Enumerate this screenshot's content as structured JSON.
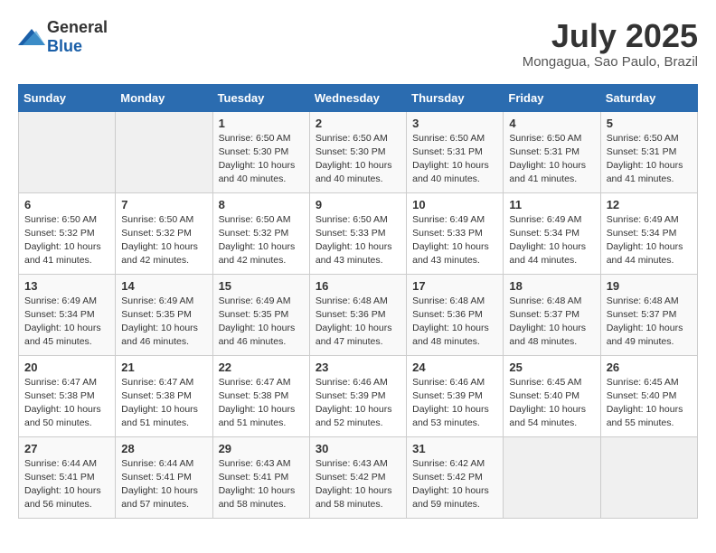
{
  "header": {
    "logo": {
      "general": "General",
      "blue": "Blue"
    },
    "title": "July 2025",
    "location": "Mongagua, Sao Paulo, Brazil"
  },
  "calendar": {
    "weekdays": [
      "Sunday",
      "Monday",
      "Tuesday",
      "Wednesday",
      "Thursday",
      "Friday",
      "Saturday"
    ],
    "weeks": [
      [
        {
          "day": "",
          "info": ""
        },
        {
          "day": "",
          "info": ""
        },
        {
          "day": "1",
          "info": "Sunrise: 6:50 AM\nSunset: 5:30 PM\nDaylight: 10 hours\nand 40 minutes."
        },
        {
          "day": "2",
          "info": "Sunrise: 6:50 AM\nSunset: 5:30 PM\nDaylight: 10 hours\nand 40 minutes."
        },
        {
          "day": "3",
          "info": "Sunrise: 6:50 AM\nSunset: 5:31 PM\nDaylight: 10 hours\nand 40 minutes."
        },
        {
          "day": "4",
          "info": "Sunrise: 6:50 AM\nSunset: 5:31 PM\nDaylight: 10 hours\nand 41 minutes."
        },
        {
          "day": "5",
          "info": "Sunrise: 6:50 AM\nSunset: 5:31 PM\nDaylight: 10 hours\nand 41 minutes."
        }
      ],
      [
        {
          "day": "6",
          "info": "Sunrise: 6:50 AM\nSunset: 5:32 PM\nDaylight: 10 hours\nand 41 minutes."
        },
        {
          "day": "7",
          "info": "Sunrise: 6:50 AM\nSunset: 5:32 PM\nDaylight: 10 hours\nand 42 minutes."
        },
        {
          "day": "8",
          "info": "Sunrise: 6:50 AM\nSunset: 5:32 PM\nDaylight: 10 hours\nand 42 minutes."
        },
        {
          "day": "9",
          "info": "Sunrise: 6:50 AM\nSunset: 5:33 PM\nDaylight: 10 hours\nand 43 minutes."
        },
        {
          "day": "10",
          "info": "Sunrise: 6:49 AM\nSunset: 5:33 PM\nDaylight: 10 hours\nand 43 minutes."
        },
        {
          "day": "11",
          "info": "Sunrise: 6:49 AM\nSunset: 5:34 PM\nDaylight: 10 hours\nand 44 minutes."
        },
        {
          "day": "12",
          "info": "Sunrise: 6:49 AM\nSunset: 5:34 PM\nDaylight: 10 hours\nand 44 minutes."
        }
      ],
      [
        {
          "day": "13",
          "info": "Sunrise: 6:49 AM\nSunset: 5:34 PM\nDaylight: 10 hours\nand 45 minutes."
        },
        {
          "day": "14",
          "info": "Sunrise: 6:49 AM\nSunset: 5:35 PM\nDaylight: 10 hours\nand 46 minutes."
        },
        {
          "day": "15",
          "info": "Sunrise: 6:49 AM\nSunset: 5:35 PM\nDaylight: 10 hours\nand 46 minutes."
        },
        {
          "day": "16",
          "info": "Sunrise: 6:48 AM\nSunset: 5:36 PM\nDaylight: 10 hours\nand 47 minutes."
        },
        {
          "day": "17",
          "info": "Sunrise: 6:48 AM\nSunset: 5:36 PM\nDaylight: 10 hours\nand 48 minutes."
        },
        {
          "day": "18",
          "info": "Sunrise: 6:48 AM\nSunset: 5:37 PM\nDaylight: 10 hours\nand 48 minutes."
        },
        {
          "day": "19",
          "info": "Sunrise: 6:48 AM\nSunset: 5:37 PM\nDaylight: 10 hours\nand 49 minutes."
        }
      ],
      [
        {
          "day": "20",
          "info": "Sunrise: 6:47 AM\nSunset: 5:38 PM\nDaylight: 10 hours\nand 50 minutes."
        },
        {
          "day": "21",
          "info": "Sunrise: 6:47 AM\nSunset: 5:38 PM\nDaylight: 10 hours\nand 51 minutes."
        },
        {
          "day": "22",
          "info": "Sunrise: 6:47 AM\nSunset: 5:38 PM\nDaylight: 10 hours\nand 51 minutes."
        },
        {
          "day": "23",
          "info": "Sunrise: 6:46 AM\nSunset: 5:39 PM\nDaylight: 10 hours\nand 52 minutes."
        },
        {
          "day": "24",
          "info": "Sunrise: 6:46 AM\nSunset: 5:39 PM\nDaylight: 10 hours\nand 53 minutes."
        },
        {
          "day": "25",
          "info": "Sunrise: 6:45 AM\nSunset: 5:40 PM\nDaylight: 10 hours\nand 54 minutes."
        },
        {
          "day": "26",
          "info": "Sunrise: 6:45 AM\nSunset: 5:40 PM\nDaylight: 10 hours\nand 55 minutes."
        }
      ],
      [
        {
          "day": "27",
          "info": "Sunrise: 6:44 AM\nSunset: 5:41 PM\nDaylight: 10 hours\nand 56 minutes."
        },
        {
          "day": "28",
          "info": "Sunrise: 6:44 AM\nSunset: 5:41 PM\nDaylight: 10 hours\nand 57 minutes."
        },
        {
          "day": "29",
          "info": "Sunrise: 6:43 AM\nSunset: 5:41 PM\nDaylight: 10 hours\nand 58 minutes."
        },
        {
          "day": "30",
          "info": "Sunrise: 6:43 AM\nSunset: 5:42 PM\nDaylight: 10 hours\nand 58 minutes."
        },
        {
          "day": "31",
          "info": "Sunrise: 6:42 AM\nSunset: 5:42 PM\nDaylight: 10 hours\nand 59 minutes."
        },
        {
          "day": "",
          "info": ""
        },
        {
          "day": "",
          "info": ""
        }
      ]
    ]
  }
}
